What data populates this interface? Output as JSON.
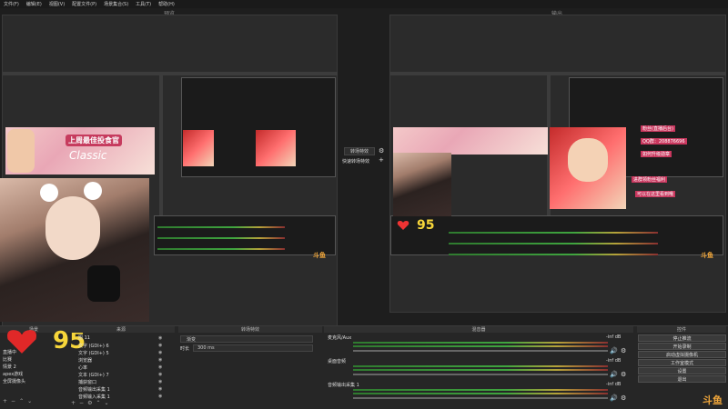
{
  "menu": [
    "文件(F)",
    "编辑(E)",
    "视图(V)",
    "配置文件(P)",
    "场景集合(S)",
    "工具(T)",
    "帮助(H)"
  ],
  "preview_label": "预览",
  "program_label": "输出",
  "transition_buttons": {
    "transition": "转场特效",
    "quick": "快速转场特效",
    "gear": "⚙",
    "plus": "+"
  },
  "overlay": {
    "banner_text": "上周最佳投食官",
    "classic_text": "Classic",
    "score": "95",
    "right_overlay_lines": [
      "粉丝(直播后台)",
      "QQ群：208876696",
      "如何升级勋章",
      "进群领粉丝福利",
      "可以在这里看到哦"
    ]
  },
  "watermark": "斗鱼",
  "scenes": {
    "header": "场景",
    "items": [
      "直播中",
      "比赛",
      "情景 2",
      "apex游戏",
      "全屏摄像头"
    ]
  },
  "sources": {
    "header": "来源",
    "items": [
      "图 11",
      "文字 (GDI+) 6",
      "文字 (GDI+) 5",
      "浏览器",
      "心率",
      "文本 (GDI+) 7",
      "捕获窗口",
      "音频输出采集 1",
      "音频输入采集 1"
    ]
  },
  "transitions": {
    "header": "转场特效",
    "type": "渐变",
    "duration_label": "时长",
    "duration_value": "300 ms"
  },
  "mixer": {
    "header": "混音器",
    "channels": [
      {
        "name": "麦克风/Aux",
        "db": "-inf dB"
      },
      {
        "name": "桌面音频",
        "db": "-inf dB"
      },
      {
        "name": "音频输出采集 1",
        "db": "-inf dB"
      }
    ]
  },
  "controls": {
    "header": "控件",
    "buttons": [
      "停止推流",
      "开始录制",
      "启动虚拟摄像机",
      "工作室模式",
      "设置",
      "退出"
    ]
  },
  "colors": {
    "accent": "#3fa53f",
    "score": "#f7d63a",
    "watermark": "#f0a63a"
  }
}
